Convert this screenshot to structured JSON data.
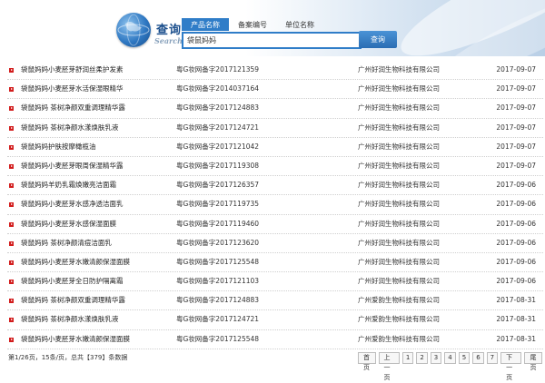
{
  "header": {
    "logo_title": "查询",
    "logo_subtitle": "Search",
    "tabs": [
      {
        "label": "产品名称",
        "active": true
      },
      {
        "label": "备案编号",
        "active": false
      },
      {
        "label": "单位名称",
        "active": false
      }
    ],
    "search_value": "袋鼠妈妈",
    "search_button": "查询"
  },
  "rows": [
    {
      "name": "袋鼠妈妈小麦胚芽舒润丝柔护发素",
      "reg": "粤G妆网备字2017121359",
      "company": "广州好润生物科技有限公司",
      "date": "2017-09-07"
    },
    {
      "name": "袋鼠妈妈小麦胚芽水活保湿眼精华",
      "reg": "粤G妆网备字2014037164",
      "company": "广州好润生物科技有限公司",
      "date": "2017-09-07"
    },
    {
      "name": "袋鼠妈妈 茶树净颜双重调理精华露",
      "reg": "粤G妆网备字2017124883",
      "company": "广州好润生物科技有限公司",
      "date": "2017-09-07"
    },
    {
      "name": "袋鼠妈妈 茶树净颜水漾焕肤乳液",
      "reg": "粤G妆网备字2017124721",
      "company": "广州好润生物科技有限公司",
      "date": "2017-09-07"
    },
    {
      "name": "袋鼠妈妈护肤按摩橄榄油",
      "reg": "粤G妆网备字2017121042",
      "company": "广州好润生物科技有限公司",
      "date": "2017-09-07"
    },
    {
      "name": "袋鼠妈妈小麦胚芽眼周保湿精华露",
      "reg": "粤G妆网备字2017119308",
      "company": "广州好润生物科技有限公司",
      "date": "2017-09-07"
    },
    {
      "name": "袋鼠妈妈羊奶乳霜焕嫩亮洁面霜",
      "reg": "粤G妆网备字2017126357",
      "company": "广州好润生物科技有限公司",
      "date": "2017-09-06"
    },
    {
      "name": "袋鼠妈妈小麦胚芽水感净透洁面乳",
      "reg": "粤G妆网备字2017119735",
      "company": "广州好润生物科技有限公司",
      "date": "2017-09-06"
    },
    {
      "name": "袋鼠妈妈小麦胚芽水感保湿面膜",
      "reg": "粤G妆网备字2017119460",
      "company": "广州好润生物科技有限公司",
      "date": "2017-09-06"
    },
    {
      "name": "袋鼠妈妈 茶树净颜清痘洁面乳",
      "reg": "粤G妆网备字2017123620",
      "company": "广州好润生物科技有限公司",
      "date": "2017-09-06"
    },
    {
      "name": "袋鼠妈妈小麦胚芽水嫩清颜保湿面膜",
      "reg": "粤G妆网备字2017125548",
      "company": "广州好润生物科技有限公司",
      "date": "2017-09-06"
    },
    {
      "name": "袋鼠妈妈小麦胚芽全日防护隔离霜",
      "reg": "粤G妆网备字2017121103",
      "company": "广州好润生物科技有限公司",
      "date": "2017-09-06"
    },
    {
      "name": "袋鼠妈妈 茶树净颜双重调理精华露",
      "reg": "粤G妆网备字2017124883",
      "company": "广州爱韵生物科技有限公司",
      "date": "2017-08-31"
    },
    {
      "name": "袋鼠妈妈 茶树净颜水漾焕肤乳液",
      "reg": "粤G妆网备字2017124721",
      "company": "广州爱韵生物科技有限公司",
      "date": "2017-08-31"
    },
    {
      "name": "袋鼠妈妈小麦胚芽水嫩清颜保湿面膜",
      "reg": "粤G妆网备字2017125548",
      "company": "广州爱韵生物科技有限公司",
      "date": "2017-08-31"
    }
  ],
  "footer": {
    "info": "第1/26页，15条/页，总共【379】条数据",
    "pager": [
      "首页",
      "上一页",
      "1",
      "2",
      "3",
      "4",
      "5",
      "6",
      "7",
      "下一页",
      "尾页"
    ]
  },
  "colors": {
    "accent": "#2f7dc8",
    "bullet": "#d21c1c"
  }
}
